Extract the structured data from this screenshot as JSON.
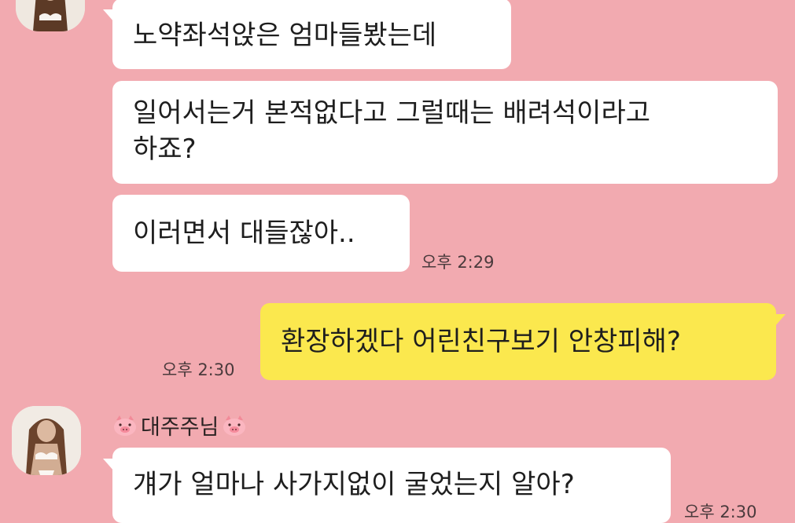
{
  "messages_top": [
    {
      "text": "노약좌석앉은 엄마들봤는데"
    },
    {
      "text_line1": "일어서는거 본적없다고 그럴때는 배려석이라고",
      "text_line2": "하죠?"
    },
    {
      "text": "이러면서 대들잖아..",
      "time": "오후 2:29"
    }
  ],
  "my_message": {
    "text": "환장하겠다 어린친구보기 안창피해?",
    "time": "오후 2:30"
  },
  "sender_block": {
    "name": "대주주님",
    "message": "걔가 얼마나 사가지없이 굴었는지 알아?",
    "time": "오후 2:30"
  },
  "colors": {
    "background": "#f2aab0",
    "incoming_bubble": "#ffffff",
    "outgoing_bubble": "#fbe84e"
  },
  "icons": [
    "avatar",
    "pig-face-icon"
  ]
}
